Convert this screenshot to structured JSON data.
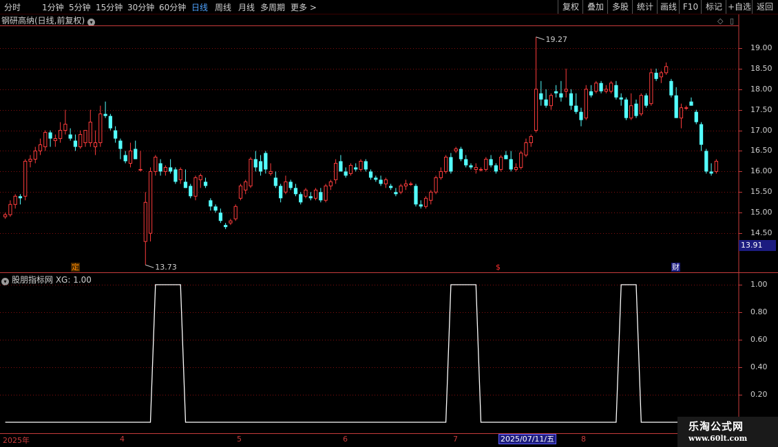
{
  "toolbar": {
    "periods": [
      "分时",
      "1分钟",
      "5分钟",
      "15分钟",
      "30分钟",
      "60分钟",
      "日线",
      "周线",
      "月线",
      "多周期",
      "更多 >"
    ],
    "active_period": "日线",
    "right_buttons": [
      "复权",
      "叠加",
      "多股",
      "统计",
      "画线",
      "F10",
      "标记",
      "+自选",
      "返回"
    ]
  },
  "stock_title": "钢研高纳(日线,前复权)",
  "indicator_title": "股朋指标网 XG: 1.00",
  "current_price_label": "13.91",
  "events": [
    {
      "label": "定",
      "color": "#ff8a00",
      "bg": "#4a2a00"
    },
    {
      "label": "$",
      "color": "#ff3030",
      "bg": "#000"
    },
    {
      "label": "财",
      "color": "#ffffff",
      "bg": "#1c1c80"
    }
  ],
  "highlight_date": "2025/07/11/五",
  "watermark": {
    "line1": "乐淘公式网",
    "line2": "www.60lt.com"
  },
  "colors": {
    "up": "#ff3c3c",
    "down": "#54ffff",
    "grid": "#8a1010",
    "axis": "#c83c3c",
    "line": "#ffffff"
  },
  "chart_data": [
    {
      "type": "candlestick",
      "title": "钢研高纳(日线,前复权)",
      "y_ticks": [
        19.0,
        18.5,
        18.0,
        17.5,
        17.0,
        16.5,
        16.0,
        15.5,
        15.0,
        14.5
      ],
      "ylim": [
        13.55,
        19.55
      ],
      "grid": true,
      "x_labels": [
        "2025年",
        "4",
        "5",
        "6",
        "7",
        "2025/07/11/五",
        "8"
      ],
      "annotations": [
        {
          "text": "19.27",
          "value": 19.27
        },
        {
          "text": "13.73",
          "value": 13.73
        }
      ],
      "ohlc": [
        [
          14.9,
          15.0,
          14.85,
          14.95
        ],
        [
          14.95,
          15.3,
          14.9,
          15.2
        ],
        [
          15.2,
          15.45,
          15.1,
          15.4
        ],
        [
          15.4,
          15.45,
          15.2,
          15.35
        ],
        [
          15.4,
          16.3,
          15.3,
          16.25
        ],
        [
          16.25,
          16.4,
          16.1,
          16.3
        ],
        [
          16.3,
          16.6,
          16.2,
          16.5
        ],
        [
          16.5,
          16.8,
          16.4,
          16.65
        ],
        [
          16.6,
          17.0,
          16.5,
          16.95
        ],
        [
          16.95,
          17.0,
          16.6,
          16.8
        ],
        [
          16.75,
          16.9,
          16.6,
          16.8
        ],
        [
          16.8,
          17.2,
          16.7,
          17.0
        ],
        [
          17.0,
          17.5,
          16.9,
          17.15
        ],
        [
          16.9,
          17.05,
          16.75,
          16.8
        ],
        [
          16.75,
          16.9,
          16.5,
          16.6
        ],
        [
          16.6,
          17.0,
          16.55,
          16.9
        ],
        [
          16.7,
          17.0,
          16.6,
          17.0
        ],
        [
          16.7,
          17.5,
          16.6,
          17.2
        ],
        [
          16.6,
          17.0,
          16.4,
          16.7
        ],
        [
          16.7,
          17.6,
          16.6,
          17.4
        ],
        [
          17.4,
          17.7,
          17.3,
          17.35
        ],
        [
          17.35,
          17.4,
          17.0,
          17.05
        ],
        [
          17.0,
          17.1,
          16.7,
          16.8
        ],
        [
          16.75,
          16.8,
          16.3,
          16.55
        ],
        [
          16.4,
          16.5,
          16.2,
          16.25
        ],
        [
          16.2,
          16.7,
          16.1,
          16.5
        ],
        [
          16.55,
          16.75,
          16.3,
          16.3
        ],
        [
          16.05,
          16.5,
          16.0,
          16.05
        ],
        [
          14.3,
          15.5,
          13.73,
          15.25
        ],
        [
          14.5,
          16.1,
          14.3,
          16.0
        ],
        [
          16.0,
          16.4,
          15.9,
          16.35
        ],
        [
          16.2,
          16.3,
          15.9,
          16.0
        ],
        [
          16.0,
          16.15,
          15.9,
          16.1
        ],
        [
          16.1,
          16.3,
          15.95,
          16.0
        ],
        [
          16.05,
          16.1,
          15.7,
          15.75
        ],
        [
          15.8,
          16.1,
          15.7,
          16.05
        ],
        [
          15.75,
          16.05,
          15.6,
          15.6
        ],
        [
          15.65,
          15.7,
          15.35,
          15.4
        ],
        [
          15.4,
          15.9,
          15.3,
          15.85
        ],
        [
          15.8,
          15.95,
          15.6,
          15.9
        ],
        [
          15.75,
          15.85,
          15.6,
          15.65
        ],
        [
          15.3,
          15.35,
          15.05,
          15.15
        ],
        [
          15.15,
          15.2,
          15.0,
          15.05
        ],
        [
          15.0,
          15.1,
          14.75,
          14.8
        ],
        [
          14.7,
          14.75,
          14.6,
          14.65
        ],
        [
          14.75,
          14.85,
          14.7,
          14.8
        ],
        [
          14.85,
          15.2,
          14.8,
          15.15
        ],
        [
          15.35,
          15.7,
          15.3,
          15.65
        ],
        [
          15.55,
          15.8,
          15.45,
          15.75
        ],
        [
          15.65,
          16.35,
          15.6,
          16.3
        ],
        [
          16.3,
          16.5,
          16.0,
          16.1
        ],
        [
          16.25,
          16.4,
          15.9,
          16.0
        ],
        [
          16.45,
          16.5,
          15.95,
          16.05
        ],
        [
          15.95,
          16.2,
          15.9,
          16.0
        ],
        [
          15.85,
          16.0,
          15.6,
          15.65
        ],
        [
          15.65,
          15.7,
          15.25,
          15.35
        ],
        [
          15.5,
          15.9,
          15.45,
          15.75
        ],
        [
          15.75,
          15.8,
          15.55,
          15.6
        ],
        [
          15.6,
          15.7,
          15.4,
          15.45
        ],
        [
          15.45,
          15.5,
          15.2,
          15.25
        ],
        [
          15.4,
          15.6,
          15.35,
          15.55
        ],
        [
          15.4,
          15.5,
          15.3,
          15.35
        ],
        [
          15.35,
          15.6,
          15.3,
          15.55
        ],
        [
          15.5,
          15.6,
          15.25,
          15.3
        ],
        [
          15.3,
          15.7,
          15.25,
          15.65
        ],
        [
          15.65,
          15.8,
          15.55,
          15.75
        ],
        [
          15.8,
          16.3,
          15.7,
          16.2
        ],
        [
          16.25,
          16.4,
          16.0,
          16.0
        ],
        [
          16.0,
          16.1,
          15.85,
          15.9
        ],
        [
          15.95,
          16.2,
          15.9,
          16.15
        ],
        [
          16.1,
          16.2,
          16.0,
          16.05
        ],
        [
          16.05,
          16.3,
          16.0,
          16.25
        ],
        [
          16.25,
          16.3,
          16.0,
          16.05
        ],
        [
          16.0,
          16.05,
          15.8,
          15.85
        ],
        [
          15.85,
          15.9,
          15.75,
          15.8
        ],
        [
          15.8,
          15.9,
          15.65,
          15.7
        ],
        [
          15.7,
          15.85,
          15.6,
          15.8
        ],
        [
          15.65,
          15.7,
          15.55,
          15.6
        ],
        [
          15.5,
          15.6,
          15.4,
          15.45
        ],
        [
          15.5,
          15.7,
          15.45,
          15.65
        ],
        [
          15.65,
          15.8,
          15.55,
          15.7
        ],
        [
          15.7,
          15.75,
          15.65,
          15.7
        ],
        [
          15.65,
          15.7,
          15.15,
          15.2
        ],
        [
          15.2,
          15.3,
          15.1,
          15.15
        ],
        [
          15.15,
          15.4,
          15.1,
          15.35
        ],
        [
          15.3,
          15.55,
          15.2,
          15.5
        ],
        [
          15.5,
          15.9,
          15.45,
          15.85
        ],
        [
          15.85,
          16.1,
          15.8,
          16.0
        ],
        [
          16.0,
          16.4,
          15.95,
          16.35
        ],
        [
          16.35,
          16.45,
          15.95,
          16.0
        ],
        [
          16.5,
          16.6,
          16.45,
          16.55
        ],
        [
          16.55,
          16.6,
          16.25,
          16.3
        ],
        [
          16.3,
          16.4,
          16.1,
          16.15
        ],
        [
          16.15,
          16.2,
          16.05,
          16.1
        ],
        [
          16.05,
          16.2,
          15.95,
          16.1
        ],
        [
          16.05,
          16.1,
          16.0,
          16.05
        ],
        [
          16.05,
          16.35,
          16.0,
          16.3
        ],
        [
          16.3,
          16.4,
          16.1,
          16.15
        ],
        [
          16.15,
          16.2,
          15.95,
          16.0
        ],
        [
          16.05,
          16.4,
          16.0,
          16.35
        ],
        [
          16.4,
          16.5,
          16.3,
          16.3
        ],
        [
          16.3,
          16.5,
          16.0,
          16.05
        ],
        [
          16.05,
          16.2,
          16.0,
          16.1
        ],
        [
          16.1,
          16.5,
          16.05,
          16.45
        ],
        [
          16.4,
          16.8,
          16.35,
          16.7
        ],
        [
          16.7,
          16.9,
          16.6,
          16.85
        ],
        [
          17.0,
          19.27,
          16.95,
          18.0
        ],
        [
          17.9,
          18.2,
          17.6,
          17.75
        ],
        [
          17.75,
          18.0,
          17.55,
          17.6
        ],
        [
          17.6,
          17.9,
          17.5,
          17.85
        ],
        [
          17.95,
          18.1,
          17.8,
          17.9
        ],
        [
          17.9,
          18.2,
          17.7,
          17.8
        ],
        [
          17.95,
          18.5,
          17.8,
          18.0
        ],
        [
          17.9,
          18.0,
          17.5,
          17.6
        ],
        [
          17.6,
          17.9,
          17.4,
          17.45
        ],
        [
          17.45,
          17.55,
          17.1,
          17.25
        ],
        [
          17.3,
          18.1,
          17.25,
          18.0
        ],
        [
          17.95,
          18.1,
          17.8,
          17.85
        ],
        [
          17.95,
          18.2,
          17.9,
          18.15
        ],
        [
          18.15,
          18.2,
          17.9,
          17.95
        ],
        [
          17.95,
          18.1,
          17.9,
          18.0
        ],
        [
          17.95,
          18.2,
          17.9,
          18.15
        ],
        [
          18.1,
          18.2,
          17.75,
          17.8
        ],
        [
          17.8,
          17.9,
          17.6,
          17.75
        ],
        [
          17.75,
          17.8,
          17.25,
          17.3
        ],
        [
          17.3,
          17.9,
          17.25,
          17.6
        ],
        [
          17.65,
          17.75,
          17.3,
          17.35
        ],
        [
          17.4,
          17.9,
          17.35,
          17.85
        ],
        [
          17.85,
          17.9,
          17.55,
          17.6
        ],
        [
          17.65,
          18.5,
          17.6,
          18.4
        ],
        [
          18.4,
          18.5,
          18.2,
          18.25
        ],
        [
          18.3,
          18.45,
          18.15,
          18.4
        ],
        [
          18.4,
          18.65,
          18.35,
          18.55
        ],
        [
          18.2,
          18.25,
          17.8,
          17.85
        ],
        [
          17.85,
          18.05,
          17.3,
          17.3
        ],
        [
          17.3,
          17.65,
          17.05,
          17.55
        ],
        [
          17.55,
          17.6,
          17.5,
          17.55
        ],
        [
          17.7,
          17.8,
          17.6,
          17.6
        ],
        [
          17.45,
          17.5,
          17.15,
          17.2
        ],
        [
          17.15,
          17.2,
          16.5,
          16.65
        ],
        [
          16.5,
          16.55,
          15.95,
          16.0
        ],
        [
          16.0,
          16.2,
          15.9,
          15.95
        ],
        [
          16.0,
          16.3,
          15.95,
          16.25
        ]
      ]
    },
    {
      "type": "line",
      "title": "股朋指标网 XG: 1.00",
      "name": "XG",
      "y_ticks": [
        1.0,
        0.8,
        0.6,
        0.4,
        0.2
      ],
      "ylim": [
        -0.08,
        1.08
      ],
      "grid": true,
      "value_intervals": [
        {
          "start": 0,
          "end": 29,
          "value": 0
        },
        {
          "start": 30,
          "end": 35,
          "value": 1
        },
        {
          "start": 36,
          "end": 88,
          "value": 0
        },
        {
          "start": 89,
          "end": 94,
          "value": 1
        },
        {
          "start": 95,
          "end": 122,
          "value": 0
        },
        {
          "start": 123,
          "end": 126,
          "value": 1
        },
        {
          "start": 127,
          "end": 149,
          "value": 0
        },
        {
          "start": 150,
          "end": 153,
          "value": 1
        }
      ]
    }
  ]
}
